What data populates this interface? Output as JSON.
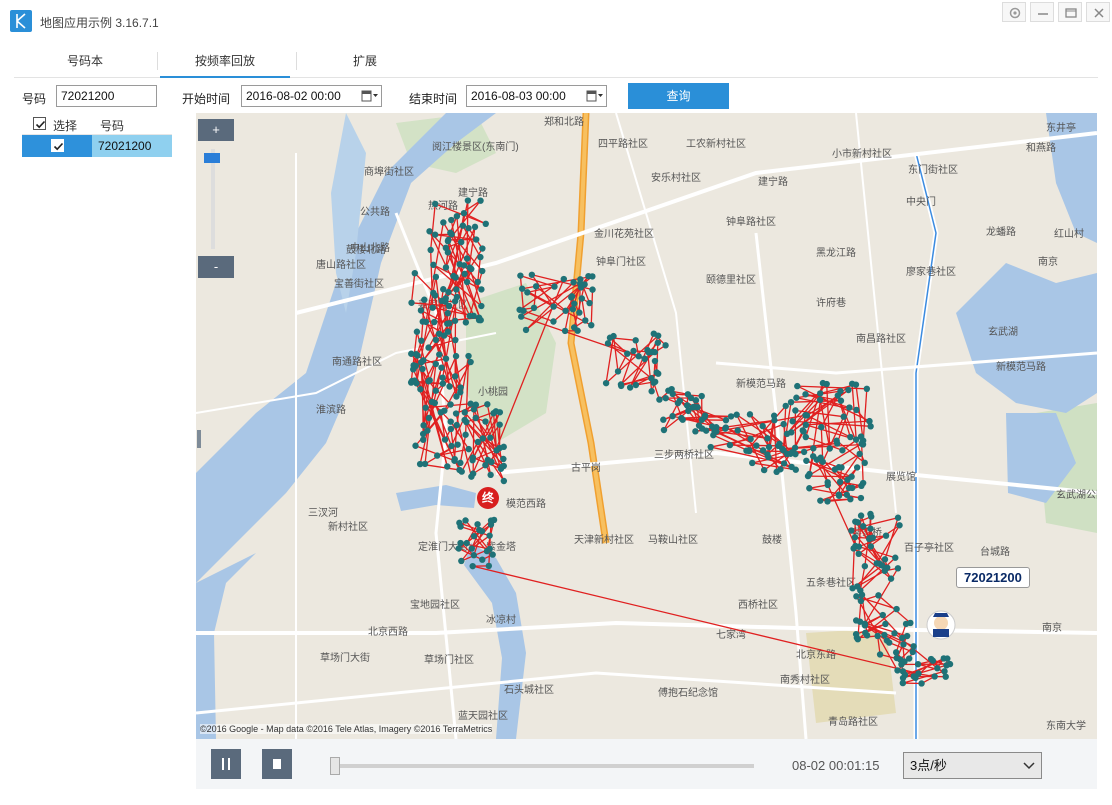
{
  "window": {
    "title": "地图应用示例 3.16.7.1"
  },
  "tabs": [
    {
      "label": "号码本"
    },
    {
      "label": "按频率回放"
    },
    {
      "label": "扩展"
    }
  ],
  "query": {
    "number_label": "号码",
    "number_value": "72021200",
    "start_label": "开始时间",
    "start_value": "2016-08-02 00:00",
    "end_label": "结束时间",
    "end_value": "2016-08-03 00:00",
    "query_button": "查询"
  },
  "list": {
    "headers": {
      "select": "选择",
      "number": "号码"
    },
    "rows": [
      {
        "checked": true,
        "number": "72021200"
      }
    ]
  },
  "map": {
    "zoom_in": "+",
    "zoom_out": "-",
    "track_label": "72021200",
    "end_marker": "终",
    "copyright": "©2016 Google - Map data ©2016 Tele Atlas, Imagery ©2016 TerraMetrics",
    "lake_label": "玄武湖",
    "city_label": "南京",
    "place_labels": [
      "郑和北路",
      "阅江楼景区(东南门)",
      "四平路社区",
      "工农新村社区",
      "东井亭",
      "和燕路",
      "小市新村社区",
      "东门街社区",
      "商埠街社区",
      "建宁路",
      "安乐村社区",
      "建宁路",
      "公共路",
      "热河路",
      "鼓楼北路",
      "中央门",
      "钟阜路社区",
      "中山北路",
      "金川花苑社区",
      "龙蟠路",
      "红山村",
      "唐山路社区",
      "钟阜门社区",
      "黑龙江路",
      "南京",
      "宝善街社区",
      "颐德里社区",
      "廖家巷社区",
      "姜家圩社区",
      "许府巷",
      "南昌路社区",
      "南通路社区",
      "小桃园",
      "新模范马路",
      "新模范马路",
      "淮滨路",
      "三步两桥社区",
      "展览馆",
      "玄武湖公园",
      "三汊河",
      "新村社区",
      "模范西路",
      "古平岗",
      "紫金塔",
      "天津新村社区",
      "马鞍山社区",
      "鼓楼",
      "裴家桥",
      "百子亭社区",
      "台城路",
      "定淮门大街",
      "五条巷社区",
      "宝地园社区",
      "冰凉村",
      "北京西路",
      "七家湾",
      "草场门大街",
      "草场门社区",
      "西桥社区",
      "北京东路",
      "南秀村社区",
      "傅抱石纪念馆",
      "石头城社区",
      "蓝天园社区",
      "青岛路社区",
      "东南大学"
    ]
  },
  "playback": {
    "time": "08-02 00:01:15",
    "speed": "3点/秒"
  },
  "colors": {
    "accent": "#2a8fd8",
    "track_point": "#1f7277",
    "track_line": "#e02020",
    "button_dark": "#5a6a7c"
  }
}
